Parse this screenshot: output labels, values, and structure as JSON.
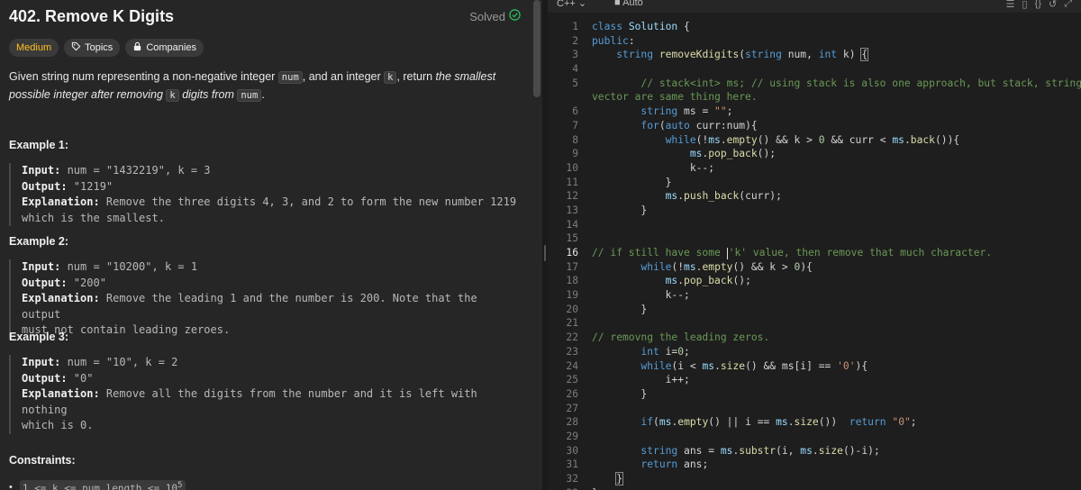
{
  "problem": {
    "title": "402. Remove K Digits",
    "solved_label": "Solved",
    "tags": {
      "difficulty": "Medium",
      "topics": "Topics",
      "companies": "Companies"
    },
    "description": {
      "p1": "Given string num representing a non-negative integer ",
      "code_num": "num",
      "p2": ", and an integer ",
      "code_k": "k",
      "p3": ", return ",
      "em1": "the smallest possible integer after removing ",
      "code_k2": "k",
      "em2": " digits from ",
      "code_num2": "num",
      "p4": "."
    },
    "examples": [
      {
        "heading": "Example 1:",
        "input_label": "Input:",
        "input": " num = \"1432219\", k = 3",
        "output_label": "Output:",
        "output": " \"1219\"",
        "expl_label": "Explanation:",
        "expl1": " Remove the three digits 4, 3, and 2 to form the new number 1219",
        "expl2": "which is the smallest."
      },
      {
        "heading": "Example 2:",
        "input_label": "Input:",
        "input": " num = \"10200\", k = 1",
        "output_label": "Output:",
        "output": " \"200\"",
        "expl_label": "Explanation:",
        "expl1": " Remove the leading 1 and the number is 200. Note that the output",
        "expl2": "must not contain leading zeroes."
      },
      {
        "heading": "Example 3:",
        "input_label": "Input:",
        "input": " num = \"10\", k = 2",
        "output_label": "Output:",
        "output": " \"0\"",
        "expl_label": "Explanation:",
        "expl1": " Remove all the digits from the number and it is left with nothing",
        "expl2": "which is 0."
      }
    ],
    "constraints_heading": "Constraints:",
    "constraint1": "1 <= k <= num.length <= 10",
    "constraint1_sup": "5"
  },
  "editor": {
    "language": "C++",
    "mode": "Auto",
    "active_line": 16
  },
  "colors": {
    "medium": "#ffc01e",
    "solved": "#2cbb5d",
    "keyword": "#569cd6",
    "function": "#dcdcaa",
    "string": "#ce9178",
    "comment": "#6a9955",
    "number": "#b5cea8"
  },
  "icons": [
    "check-circle-icon",
    "tag-icon",
    "lock-icon",
    "chevron-down-icon",
    "list-icon",
    "bookmark-icon",
    "braces-icon",
    "reset-icon",
    "expand-icon"
  ]
}
